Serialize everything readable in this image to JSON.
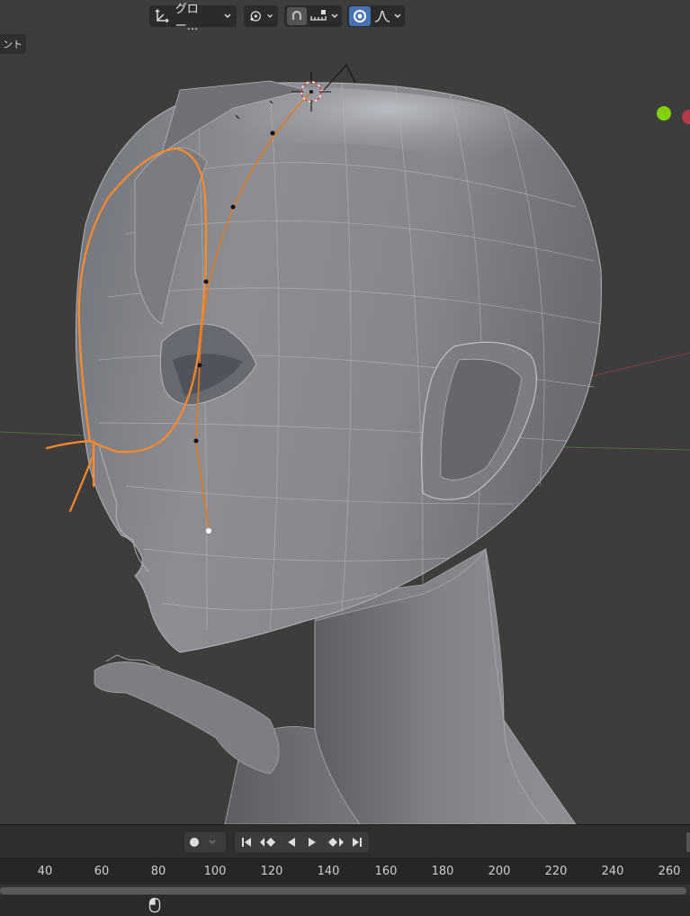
{
  "header": {
    "transform_orientation": {
      "label": "グロー...",
      "icon": "transform-orientation-icon"
    },
    "pivot": {
      "icon": "pivot-point-icon"
    },
    "snap": {
      "icon": "snap-magnet-icon",
      "element_icon": "snap-increment-icon"
    },
    "proportional": {
      "icon": "proportional-editing-icon",
      "falloff_icon": "smooth-falloff-icon"
    }
  },
  "left_tab": {
    "label": "ント"
  },
  "timeline": {
    "transport_icons": [
      "record-icon",
      "jump-start-icon",
      "prev-keyframe-icon",
      "play-reverse-icon",
      "play-icon",
      "next-keyframe-icon",
      "jump-end-icon"
    ],
    "frame_ticks": [
      "40",
      "60",
      "80",
      "100",
      "120",
      "140",
      "160",
      "180",
      "200",
      "220",
      "240",
      "260"
    ]
  },
  "colors": {
    "viewport_bg": "#3d3d3d",
    "annotation_stroke": "#ff8a2a",
    "mesh_fill": "#8a8c90",
    "gizmo_y": "#83d10e",
    "gizmo_x": "#cc3a4e",
    "active_toggle": "#4772b3"
  }
}
